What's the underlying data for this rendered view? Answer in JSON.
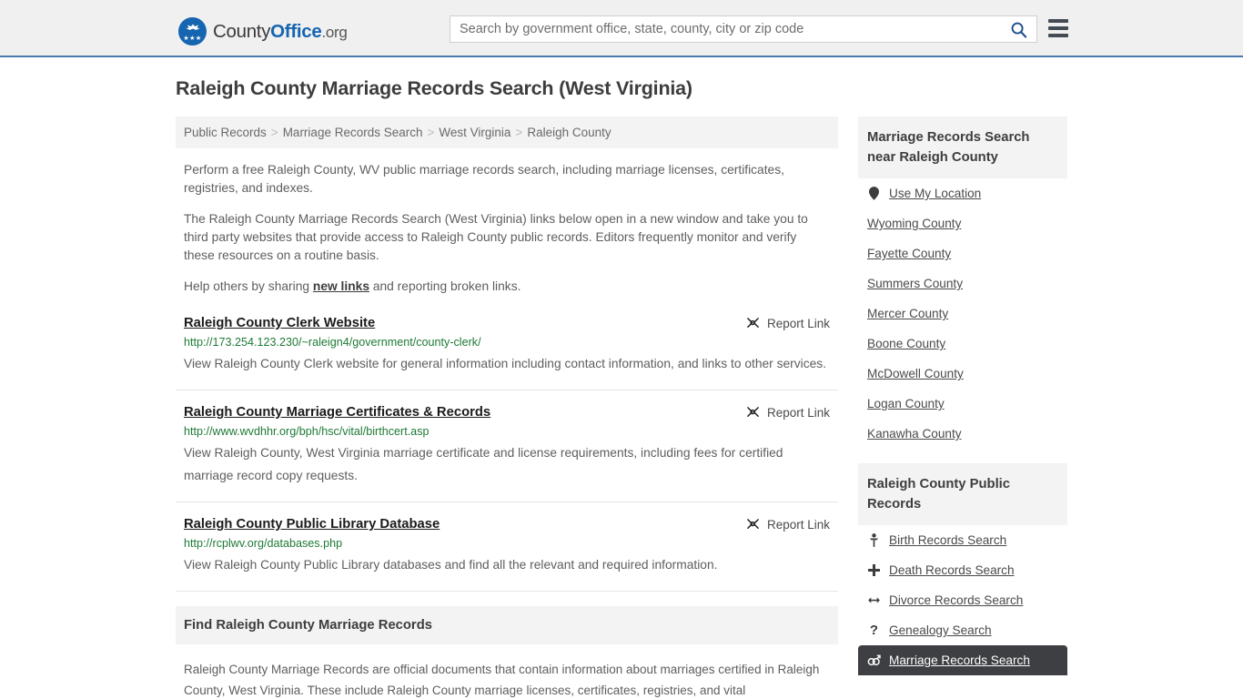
{
  "header": {
    "logo": {
      "part1": "County",
      "part2": "Office",
      "part3": ".org",
      "stars": "★★★"
    },
    "search": {
      "placeholder": "Search by government office, state, county, city or zip code",
      "value": "",
      "button_icon": "search-icon"
    },
    "menu_icon": "hamburger-menu-icon"
  },
  "page": {
    "title": "Raleigh County Marriage Records Search (West Virginia)"
  },
  "breadcrumb": {
    "items": [
      "Public Records",
      "Marriage Records Search",
      "West Virginia",
      "Raleigh County"
    ],
    "separator": ">"
  },
  "intro": {
    "p1": "Perform a free Raleigh County, WV public marriage records search, including marriage licenses, certificates, registries, and indexes.",
    "p2": "The Raleigh County Marriage Records Search (West Virginia) links below open in a new window and take you to third party websites that provide access to Raleigh County public records. Editors frequently monitor and verify these resources on a routine basis.",
    "p3_before": "Help others by sharing ",
    "p3_link": "new links",
    "p3_after": " and reporting broken links."
  },
  "report_link_label": "Report Link",
  "report_link_icon": "broken-link-icon",
  "results": [
    {
      "title": "Raleigh County Clerk Website",
      "url": "http://173.254.123.230/~raleign4/government/county-clerk/",
      "description": "View Raleigh County Clerk website for general information including contact information, and links to other services."
    },
    {
      "title": "Raleigh County Marriage Certificates & Records",
      "url": "http://www.wvdhhr.org/bph/hsc/vital/birthcert.asp",
      "description": "View Raleigh County, West Virginia marriage certificate and license requirements, including fees for certified marriage record copy requests."
    },
    {
      "title": "Raleigh County Public Library Database",
      "url": "http://rcplwv.org/databases.php",
      "description": "View Raleigh County Public Library databases and find all the relevant and required information."
    }
  ],
  "find_section": {
    "heading": "Find Raleigh County Marriage Records",
    "paragraph": "Raleigh County Marriage Records are official documents that contain information about marriages certified in Raleigh County, West Virginia. These include Raleigh County marriage licenses, certificates, registries, and vital"
  },
  "sidebar": {
    "nearby": {
      "heading": "Marriage Records Search near Raleigh County",
      "items": [
        {
          "label": "Use My Location",
          "icon": "map-pin-icon"
        },
        {
          "label": "Wyoming County",
          "icon": ""
        },
        {
          "label": "Fayette County",
          "icon": ""
        },
        {
          "label": "Summers County",
          "icon": ""
        },
        {
          "label": "Mercer County",
          "icon": ""
        },
        {
          "label": "Boone County",
          "icon": ""
        },
        {
          "label": "McDowell County",
          "icon": ""
        },
        {
          "label": "Logan County",
          "icon": ""
        },
        {
          "label": "Kanawha County",
          "icon": ""
        }
      ]
    },
    "public_records": {
      "heading": "Raleigh County Public Records",
      "items": [
        {
          "label": "Birth Records Search",
          "icon": "baby-icon",
          "glyph": "🚼",
          "active": false
        },
        {
          "label": "Death Records Search",
          "icon": "cross-icon",
          "glyph": "✚",
          "active": false
        },
        {
          "label": "Divorce Records Search",
          "icon": "double-arrow-icon",
          "glyph": "↔",
          "active": false
        },
        {
          "label": "Genealogy Search",
          "icon": "question-mark-icon",
          "glyph": "?",
          "active": false
        },
        {
          "label": "Marriage Records Search",
          "icon": "interlocking-rings-icon",
          "glyph": "⚤",
          "active": true
        }
      ]
    }
  },
  "colors": {
    "accent_blue": "#1565b0",
    "header_bg": "#f0f0f0",
    "header_border": "#4a7aab",
    "url_green": "#1e7a35",
    "panel_bg": "#f3f3f3",
    "active_bg": "#3d3f42",
    "body_text": "#5e5e5e"
  }
}
